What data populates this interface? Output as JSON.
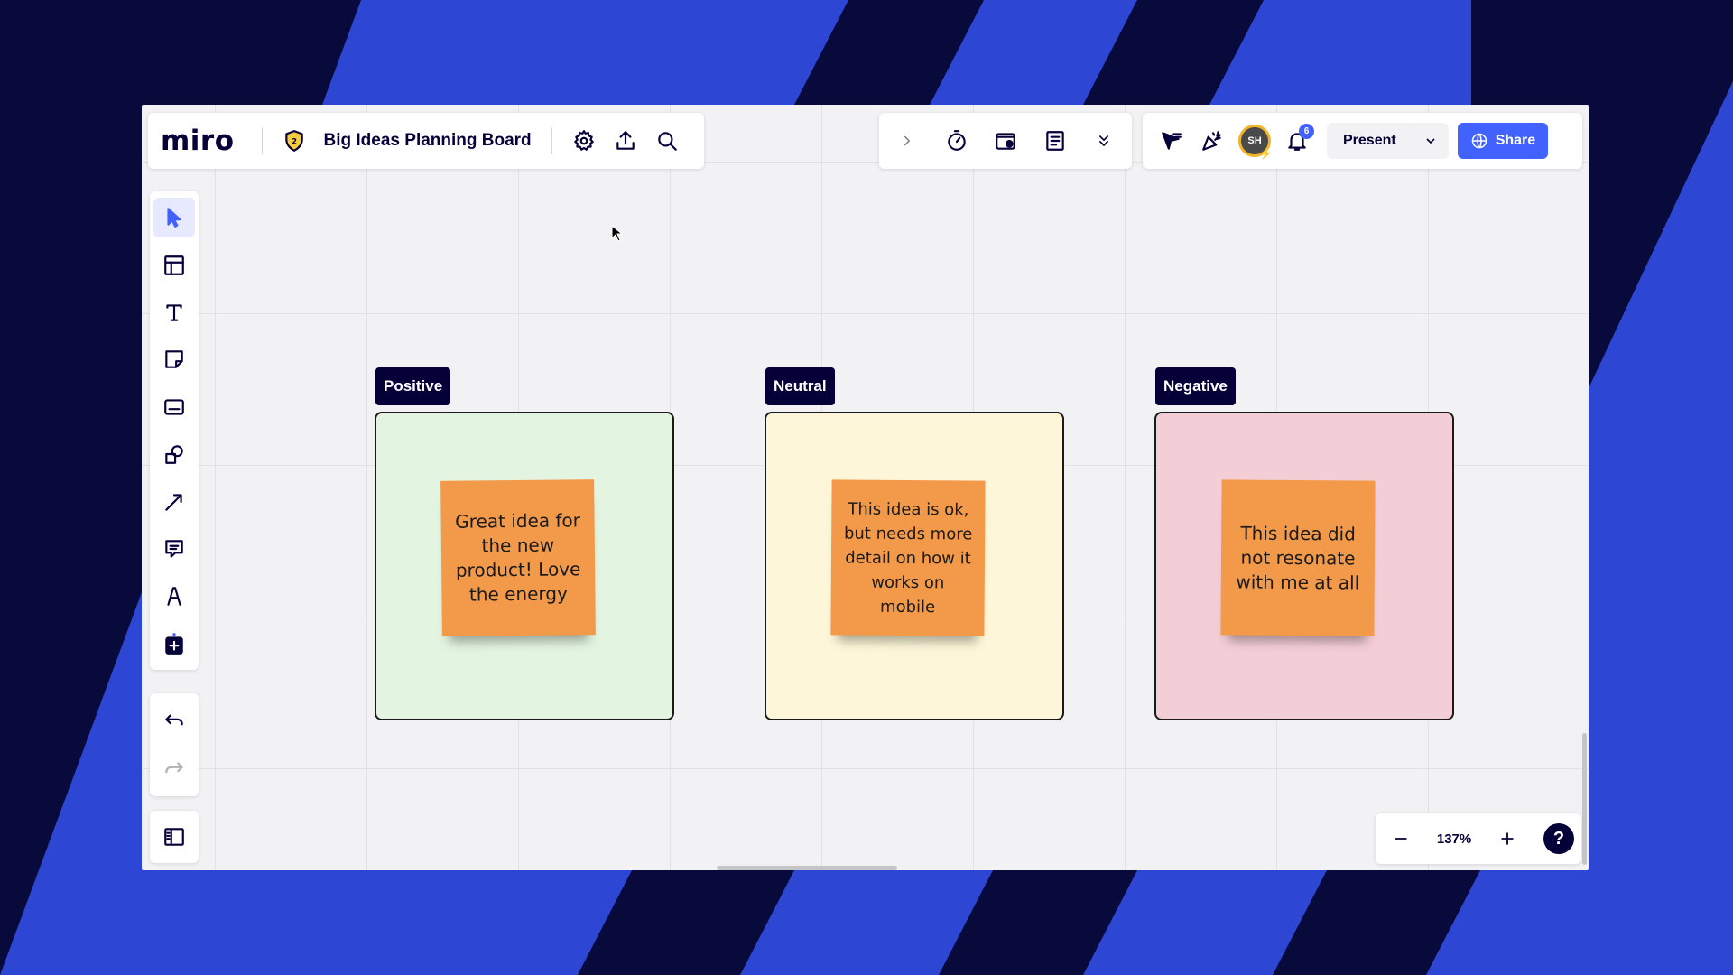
{
  "app": {
    "logo": "miro",
    "board_title": "Big Ideas Planning Board"
  },
  "top_tools": {
    "items": [
      "expand-chevron",
      "timer",
      "video-capture",
      "notes",
      "more"
    ]
  },
  "collab": {
    "avatar_initials": "SH",
    "notification_count": "6",
    "present_label": "Present",
    "share_label": "Share"
  },
  "toolbar": {
    "items": [
      "select",
      "templates",
      "text",
      "sticky-note",
      "card",
      "shapes",
      "connection-line",
      "comment",
      "pen",
      "more-apps"
    ]
  },
  "frames": [
    {
      "label": "Positive",
      "color": "#e3f4e1",
      "note": "Great idea for the new product! Love the energy"
    },
    {
      "label": "Neutral",
      "color": "#fdf6d8",
      "note": "This idea is ok, but needs more detail on how it works on mobile"
    },
    {
      "label": "Negative",
      "color": "#f4ced6",
      "note": "This idea did not resonate with me at all"
    }
  ],
  "sticky_color": "#f2994a",
  "zoom": {
    "level": "137%"
  },
  "help_label": "?",
  "colors": {
    "accent": "#4262ff",
    "dark": "#050038",
    "background": "#2d46d4"
  }
}
